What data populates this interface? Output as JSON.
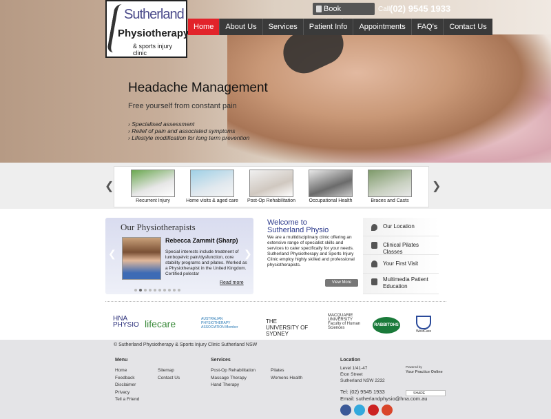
{
  "header": {
    "logo": {
      "line1": "Sutherland",
      "line2": "Physiotherapy",
      "line3": "& sports injury clinic"
    },
    "book_button": "Book Appointment",
    "call_label": "Call:",
    "call_number": "(02) 9545 1933",
    "nav": [
      "Home",
      "About Us",
      "Services",
      "Patient Info",
      "Appointments",
      "FAQ's",
      "Contact Us"
    ],
    "nav_active": "Home"
  },
  "hero": {
    "title": "Headache Management",
    "subtitle": "Free yourself from constant pain",
    "bullets": [
      "Specialised assessment",
      "Relief of pain and associated symptoms",
      "Lifestyle modification for long term prevention"
    ]
  },
  "carousel": {
    "items": [
      "Recurrent Injury",
      "Home visits & aged care",
      "Post-Op Rehabilitation",
      "Occupational Health",
      "Braces and Casts"
    ]
  },
  "physiotherapists": {
    "title": "Our Physiotherapists",
    "name": "Rebecca Zammit (Sharp)",
    "description": "Special interests include treatment of lumbopelvic pain/dysfunction, core stability programs and pilates. Worked as a Physiotherapist in the United Kingdom. Certified polestar",
    "read_more": "Read more"
  },
  "welcome": {
    "title": "Welcome to Sutherland Physio",
    "text": "We are a multidisciplinary clinic offering an extensive range of specialist skills and services to cater specifically for your needs. Sutherland Physiotherapy and Sports Injury Clinic employ highly skilled and professional physiotherapists.",
    "button": "View More"
  },
  "side_links": [
    {
      "label": "Our Location",
      "icon": "location-pin-icon"
    },
    {
      "label": "Clinical Pilates Classes",
      "icon": "pilates-icon"
    },
    {
      "label": "Your First Visit",
      "icon": "person-icon"
    },
    {
      "label": "Multimedia Patient Education",
      "icon": "film-icon"
    }
  ],
  "partners": [
    "HNA PHYSIO",
    "lifecare",
    "AUSTRALIAN PHYSIOTHERAPY ASSOCIATION Member",
    "THE UNIVERSITY OF SYDNEY",
    "MACQUARIE UNIVERSITY Faculty of Human Sciences",
    "RABBITOHS",
    "WestCare"
  ],
  "footer": {
    "copyright": "© Sutherland Physiotherapy & Sports Injury Clinic Sutherland NSW",
    "menu_heading": "Menu",
    "menu_col1": [
      "Home",
      "Feedback",
      "Disclaimer",
      "Privacy",
      "Tell a Friend"
    ],
    "menu_col2": [
      "Sitemap",
      "Contact Us"
    ],
    "services_heading": "Services",
    "services_col1": [
      "Post-Op Rehabilitation",
      "Massage Therapy",
      "Hand Therapy"
    ],
    "services_col2": [
      "Pilates",
      "Womens Health"
    ],
    "location_heading": "Location",
    "address": [
      "Level 1/41-47",
      "Eton Street",
      "Sutherland NSW 2232"
    ],
    "powered_by": "Powered by",
    "powered_brand": "Your Practice Online",
    "share": "SHARE",
    "tel": "Tel: (02) 9545 1933",
    "email": "Email: sutherlandphysio@hna.com.au",
    "social": [
      "facebook-icon",
      "twitter-icon",
      "youtube-icon",
      "google-plus-icon"
    ]
  },
  "colors": {
    "nav_active": "#e2232a",
    "nav_bg": "#3a3a3a",
    "welcome_title": "#2c3a8c",
    "footer_bg": "#e4e4e7"
  }
}
